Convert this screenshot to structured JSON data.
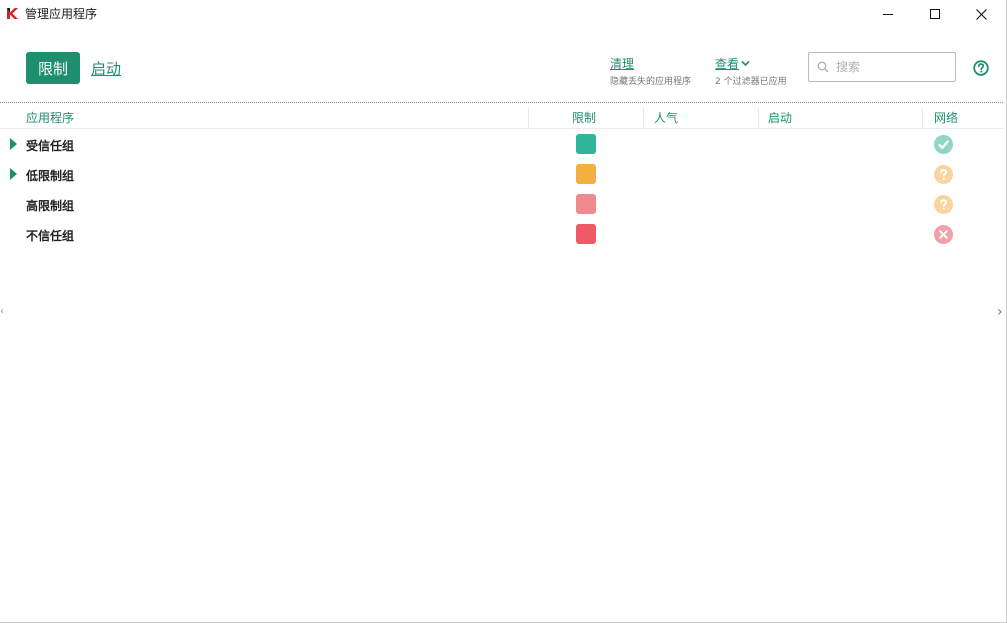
{
  "window": {
    "title": "管理应用程序",
    "controls": {
      "minimize": "—",
      "maximize": "☐",
      "close": "✕"
    }
  },
  "toolbar": {
    "mode_active": "限制",
    "mode_other": "启动",
    "clean_label": "清理",
    "clean_sub": "隐藏丢失的应用程序",
    "view_label": "查看",
    "view_sub": "2 个过滤器已应用",
    "search_placeholder": "搜索"
  },
  "table": {
    "columns": [
      "应用程序",
      "限制",
      "人气",
      "启动",
      "网络"
    ],
    "rows": [
      {
        "name": "受信任组",
        "expandable": true,
        "restrict_color": "#2eb59a",
        "network": "allowed-icon"
      },
      {
        "name": "低限制组",
        "expandable": true,
        "restrict_color": "#f5b041",
        "network": "question-icon"
      },
      {
        "name": "高限制组",
        "expandable": false,
        "restrict_color": "#ef8a8f",
        "network": "question-icon"
      },
      {
        "name": "不信任组",
        "expandable": false,
        "restrict_color": "#ef5a66",
        "network": "blocked-icon"
      }
    ]
  },
  "colors": {
    "accent": "#1e8f6e",
    "allowed": "#8fd6c6",
    "question": "#f9d49c",
    "blocked": "#f0a0a6"
  }
}
